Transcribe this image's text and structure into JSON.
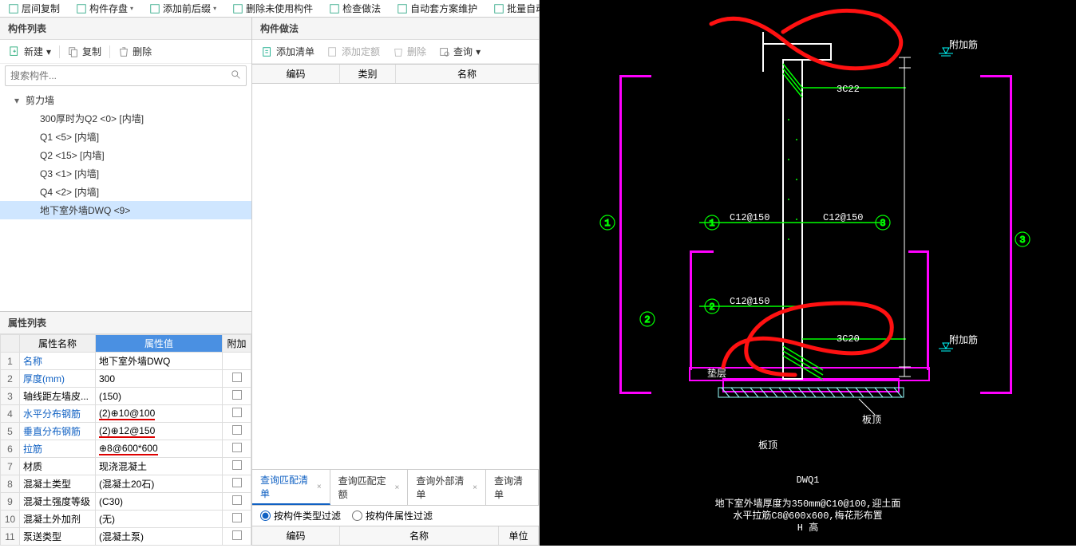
{
  "ribbon": [
    {
      "label": "层间复制",
      "icon": "copy-layers"
    },
    {
      "label": "构件存盘",
      "icon": "save",
      "dd": true
    },
    {
      "label": "添加前后缀",
      "icon": "prefix",
      "dd": true
    },
    {
      "label": "删除未使用构件",
      "icon": "delete-unused"
    },
    {
      "label": "检查做法",
      "icon": "check"
    },
    {
      "label": "自动套方案维护",
      "icon": "auto-scheme"
    },
    {
      "label": "批量自动套做法",
      "icon": "batch-auto"
    }
  ],
  "panelA_title": "构件列表",
  "panelA_toolbar": {
    "new": "新建",
    "copy": "复制",
    "delete": "删除"
  },
  "search_placeholder": "搜索构件...",
  "tree": {
    "root": "剪力墙",
    "items": [
      "300厚时为Q2 <0> [内墙]",
      "Q1 <5> [内墙]",
      "Q2 <15> [内墙]",
      "Q3 <1> [内墙]",
      "Q4 <2> [内墙]",
      "地下室外墙DWQ <9>"
    ],
    "selected_index": 5
  },
  "propPanel_title": "属性列表",
  "prop_headers": {
    "name": "属性名称",
    "value": "属性值",
    "extra": "附加"
  },
  "props": [
    {
      "n": "1",
      "name": "名称",
      "val": "地下室外墙DWQ",
      "link": true
    },
    {
      "n": "2",
      "name": "厚度(mm)",
      "val": "300",
      "link": true
    },
    {
      "n": "3",
      "name": "轴线距左墙皮...",
      "val": "(150)"
    },
    {
      "n": "4",
      "name": "水平分布钢筋",
      "val": "(2)⊕10@100",
      "link": true,
      "ul": true
    },
    {
      "n": "5",
      "name": "垂直分布钢筋",
      "val": "(2)⊕12@150",
      "link": true,
      "ul": true
    },
    {
      "n": "6",
      "name": "拉筋",
      "val": "⊕8@600*600",
      "link": true,
      "ul": true
    },
    {
      "n": "7",
      "name": "材质",
      "val": "现浇混凝土"
    },
    {
      "n": "8",
      "name": "混凝土类型",
      "val": "(混凝土20石)"
    },
    {
      "n": "9",
      "name": "混凝土强度等级",
      "val": "(C30)"
    },
    {
      "n": "10",
      "name": "混凝土外加剂",
      "val": "(无)"
    },
    {
      "n": "11",
      "name": "泵送类型",
      "val": "(混凝土泵)"
    }
  ],
  "panelB_title": "构件做法",
  "panelB_toolbar": {
    "addList": "添加清单",
    "addQuota": "添加定额",
    "delete": "删除",
    "query": "查询"
  },
  "colB_headers": {
    "code": "编码",
    "cat": "类别",
    "name": "名称"
  },
  "tabs": [
    {
      "label": "查询匹配清单",
      "active": true,
      "close": true
    },
    {
      "label": "查询匹配定额",
      "close": true
    },
    {
      "label": "查询外部清单",
      "close": true
    },
    {
      "label": "查询清单"
    }
  ],
  "filters": {
    "byType": "按构件类型过滤",
    "byProp": "按构件属性过滤"
  },
  "colB_lower_headers": {
    "code": "编码",
    "name": "名称",
    "unit": "单位"
  },
  "cad": {
    "labels": {
      "top_rebar": "3C22",
      "mid_r1": "C12@150",
      "mid_r2": "C12@150",
      "low_rebar": "C12@150",
      "bot_rebar": "3C20",
      "title": "DWQ1",
      "note1": "地下室外墙厚度为350mm@C10@100,迎土面",
      "note2": "水平拉筋C8@600x600,梅花形布置",
      "note3": "H 高",
      "tag_tl": "附加筋",
      "tag_br": "附加筋",
      "tag_bl": "垫层",
      "tag_slab": "板顶"
    },
    "circles": [
      "1",
      "2",
      "3",
      "1",
      "2",
      "3"
    ]
  }
}
